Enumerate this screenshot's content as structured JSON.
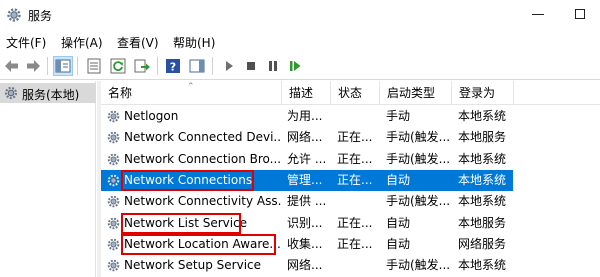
{
  "window": {
    "title": "服务",
    "minimize_glyph": "—",
    "maximize_glyph": "□"
  },
  "menu": {
    "items": [
      {
        "label": "文件(F)"
      },
      {
        "label": "操作(A)"
      },
      {
        "label": "查看(V)"
      },
      {
        "label": "帮助(H)"
      }
    ]
  },
  "toolbar": {
    "buttons": [
      "back-arrow-icon",
      "forward-arrow-icon",
      "show-hide-tree-icon",
      "properties-icon",
      "refresh-icon",
      "export-list-icon",
      "help-icon",
      "action-pane-icon",
      "start-service-icon",
      "stop-service-icon",
      "pause-service-icon",
      "resume-service-icon"
    ]
  },
  "tree": {
    "root_label": "服务(本地)"
  },
  "list": {
    "columns": [
      "名称",
      "描述",
      "状态",
      "启动类型",
      "登录为"
    ],
    "rows": [
      {
        "name": "Netlogon",
        "desc": "为用...",
        "status": "",
        "startup": "手动",
        "logon": "本地系统",
        "selected": false,
        "highlighted": false
      },
      {
        "name": "Network Connected Devi...",
        "desc": "网络...",
        "status": "正在...",
        "startup": "手动(触发...",
        "logon": "本地服务",
        "selected": false,
        "highlighted": false
      },
      {
        "name": "Network Connection Bro...",
        "desc": "允许 ...",
        "status": "正在...",
        "startup": "手动(触发...",
        "logon": "本地系统",
        "selected": false,
        "highlighted": false
      },
      {
        "name": "Network Connections",
        "desc": "管理...",
        "status": "正在...",
        "startup": "自动",
        "logon": "本地系统",
        "selected": true,
        "highlighted": true
      },
      {
        "name": "Network Connectivity Ass...",
        "desc": "提供 ...",
        "status": "",
        "startup": "手动(触发...",
        "logon": "本地系统",
        "selected": false,
        "highlighted": false
      },
      {
        "name": "Network List Service",
        "desc": "识别...",
        "status": "正在...",
        "startup": "自动",
        "logon": "本地服务",
        "selected": false,
        "highlighted": true
      },
      {
        "name": "Network Location Aware...",
        "desc": "收集...",
        "status": "正在...",
        "startup": "自动",
        "logon": "网络服务",
        "selected": false,
        "highlighted": true
      },
      {
        "name": "Network Setup Service",
        "desc": "网络...",
        "status": "",
        "startup": "手动(触发...",
        "logon": "本地系统",
        "selected": false,
        "highlighted": false
      }
    ]
  },
  "colors": {
    "selection": "#0078d7",
    "highlight_box": "#e00000",
    "tree_selected": "#d9d9d9"
  }
}
